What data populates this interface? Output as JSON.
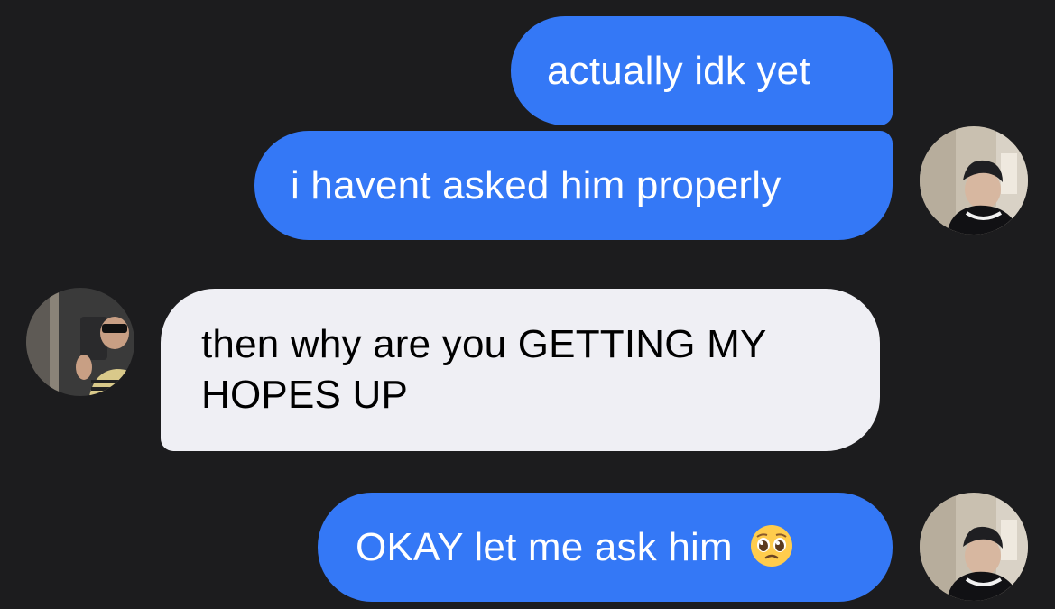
{
  "conversation": {
    "messages": [
      {
        "sender": "me",
        "text": "actually idk yet"
      },
      {
        "sender": "me",
        "text": "i havent asked him properly"
      },
      {
        "sender": "them",
        "text_lines": [
          "then why are you GETTING MY",
          "HOPES UP"
        ]
      },
      {
        "sender": "me",
        "text": "OKAY let me ask him",
        "emoji": "pleading-face-emoji"
      }
    ]
  },
  "colors": {
    "background": "#1c1c1e",
    "outgoing_bubble": "#3478f6",
    "incoming_bubble": "#efeff4",
    "outgoing_text": "#ffffff",
    "incoming_text": "#000000"
  },
  "avatars": {
    "me": "avatar-photo-icon",
    "them": "avatar-photo-icon"
  }
}
